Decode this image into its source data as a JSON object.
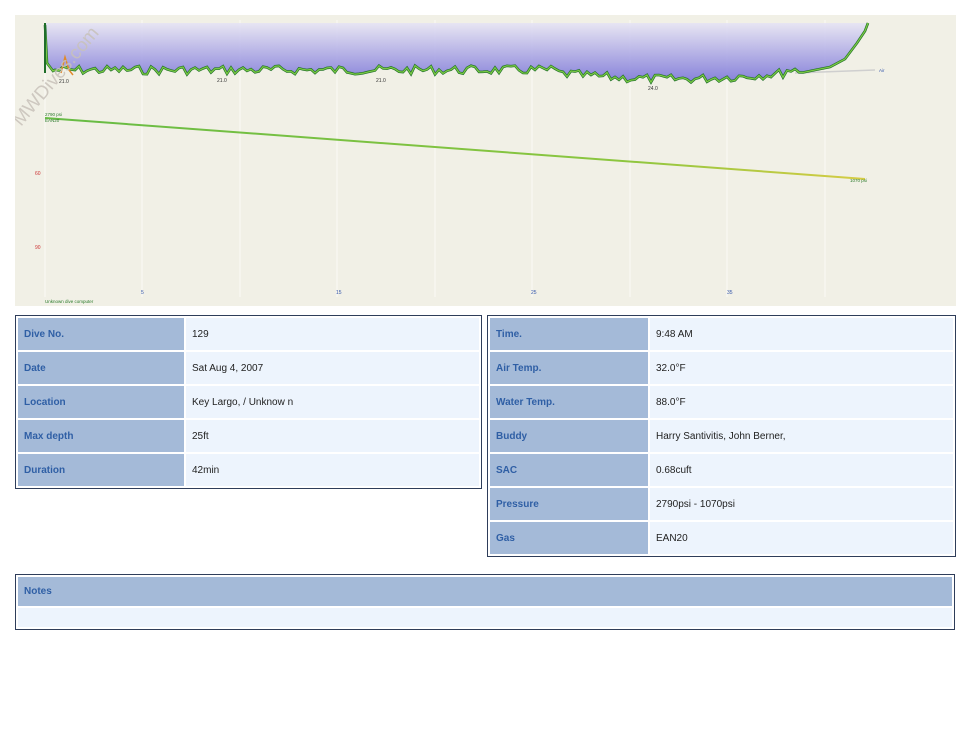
{
  "watermark": "MWDives.com",
  "profile": {
    "depth_labels": [
      "21.0",
      "21.0",
      "21.0",
      "24.0"
    ],
    "air_label": "Air",
    "y_ticks": [
      "60",
      "90"
    ],
    "x_ticks": [
      "5",
      "15",
      "25",
      "35"
    ],
    "pressure_start_label": "2790 psi",
    "pressure_gas_label": "EAN20",
    "pressure_end_label": "1070 psi",
    "computer_label": "Unknown dive computer",
    "colors": {
      "background": "#f1f0e6",
      "depth_line": "#1f6e2a",
      "depth_line_light": "#7ac943",
      "depth_fill": "#8a84dc",
      "pressure_start": "#66bb44",
      "pressure_end": "#d6cc44",
      "tick_red": "#cc3333"
    }
  },
  "left_table": [
    {
      "label": "Dive No.",
      "value": "129"
    },
    {
      "label": "Date",
      "value": "Sat Aug 4, 2007"
    },
    {
      "label": "Location",
      "value": "Key Largo, / Unknow n"
    },
    {
      "label": "Max depth",
      "value": "25ft"
    },
    {
      "label": "Duration",
      "value": "42min"
    }
  ],
  "right_table": [
    {
      "label": "Time.",
      "value": "9:48 AM"
    },
    {
      "label": "Air Temp.",
      "value": "32.0°F"
    },
    {
      "label": "Water Temp.",
      "value": "88.0°F"
    },
    {
      "label": "Buddy",
      "value": "Harry Santivitis, John Berner,"
    },
    {
      "label": "SAC",
      "value": "0.68cuft"
    },
    {
      "label": "Pressure",
      "value": "2790psi - 1070psi"
    },
    {
      "label": "Gas",
      "value": "EAN20"
    }
  ],
  "notes": {
    "label": "Notes",
    "text": ""
  }
}
